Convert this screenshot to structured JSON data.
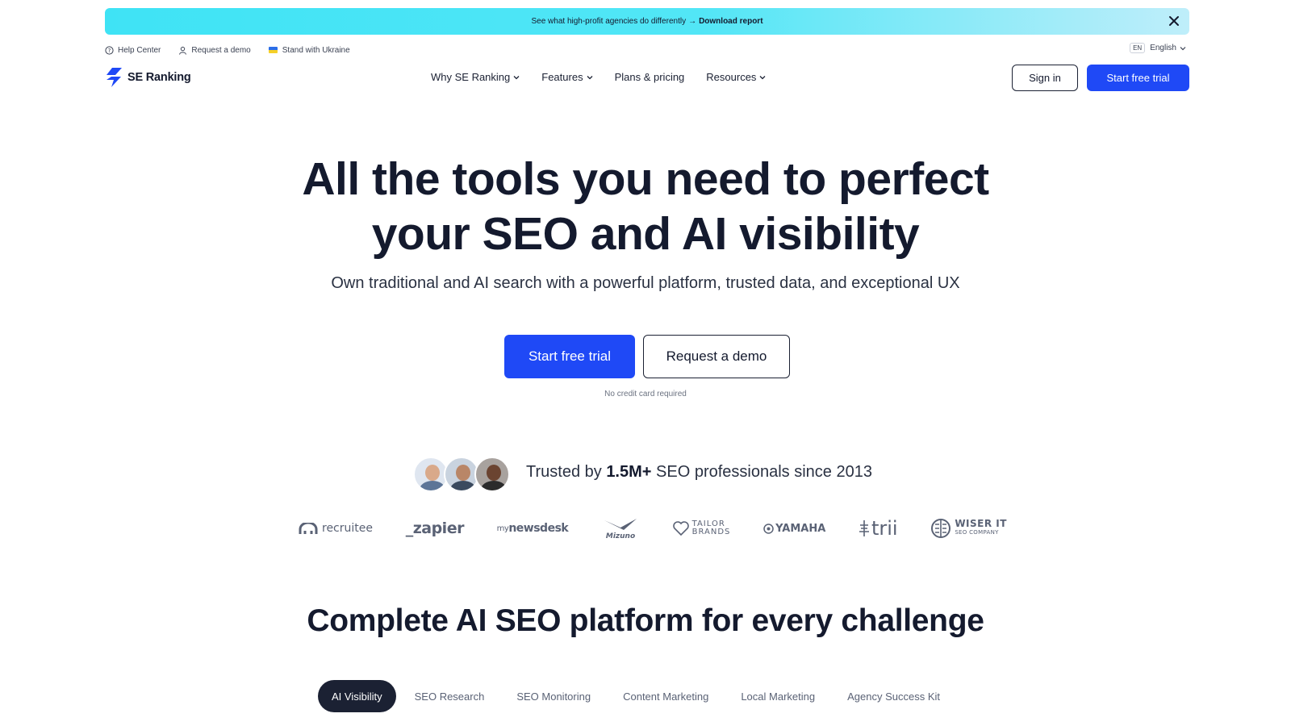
{
  "promo": {
    "text": "See what high-profit agencies do differently",
    "arrow": "→",
    "link": "Download report"
  },
  "utility": {
    "help_center": "Help Center",
    "request_demo": "Request a demo",
    "ukraine": "Stand with Ukraine",
    "lang_code": "EN",
    "lang_name": "English"
  },
  "header": {
    "logo": "SE Ranking",
    "nav": [
      "Why SE Ranking",
      "Features",
      "Plans & pricing",
      "Resources"
    ],
    "sign_in": "Sign in",
    "start_trial": "Start free trial"
  },
  "hero": {
    "title_line1": "All the tools you need to perfect",
    "title_line2": "your SEO and AI visibility",
    "subtitle": "Own traditional and AI search with a powerful platform, trusted data, and exceptional UX",
    "cta_primary": "Start free trial",
    "cta_secondary": "Request a demo",
    "note": "No credit card required"
  },
  "trusted": {
    "prefix": "Trusted by",
    "count": "1.5M+",
    "suffix": "SEO professionals since 2013"
  },
  "logos": {
    "recruitee": "recruitee",
    "zapier": "_zapier",
    "newsdesk_my": "my",
    "newsdesk": "newsdesk",
    "mizuno": "Mizuno",
    "tailor_1": "TAILOR",
    "tailor_2": "BRANDS",
    "yamaha": "YAMAHA",
    "trii": "trii",
    "wiser": "WISER IT",
    "wiser_sub": "SEO COMPANY"
  },
  "section": {
    "title": "Complete AI SEO platform for every challenge",
    "tabs": [
      "AI Visibility",
      "SEO Research",
      "SEO Monitoring",
      "Content Marketing",
      "Local Marketing",
      "Agency Success Kit"
    ]
  },
  "colors": {
    "accent": "#1f49f6",
    "dark": "#141a2e",
    "banner_start": "#3fe3f5",
    "banner_end": "#bfeefa"
  }
}
